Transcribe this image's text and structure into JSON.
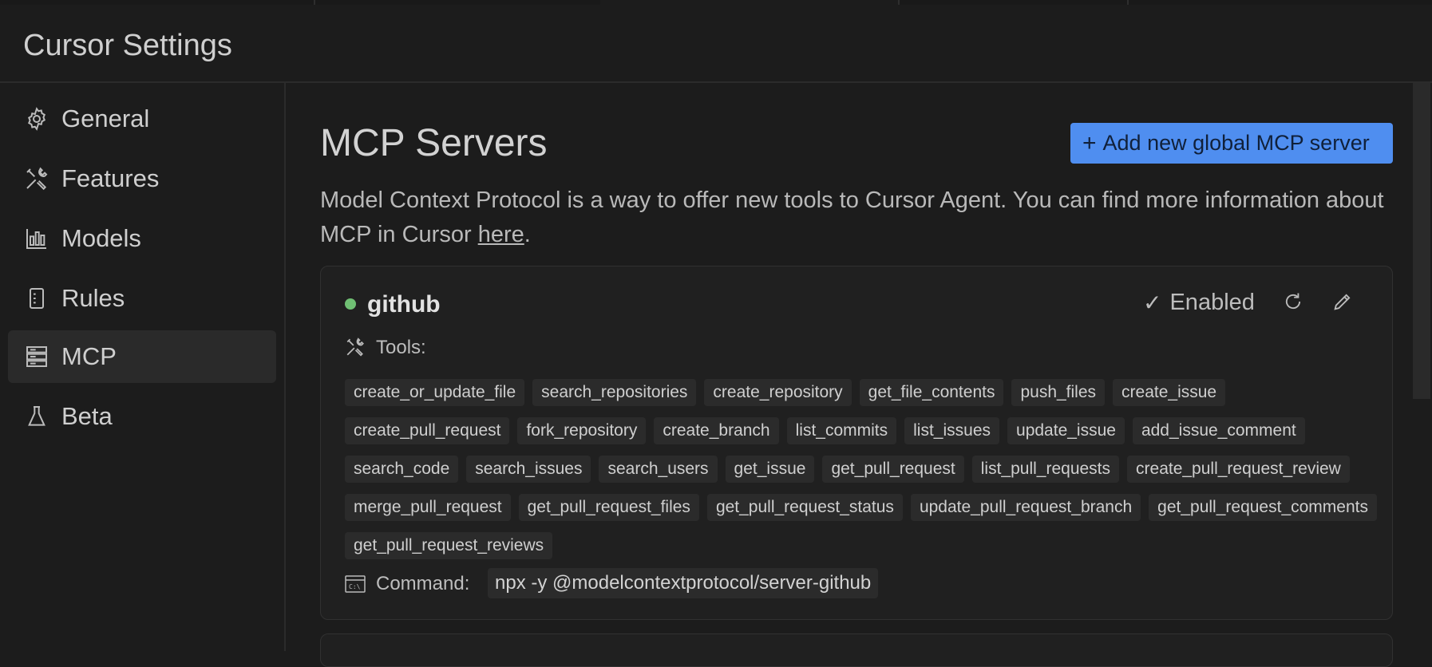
{
  "window": {
    "title": "Cursor Settings"
  },
  "sidebar": {
    "items": [
      {
        "label": "General",
        "icon": "gear-icon"
      },
      {
        "label": "Features",
        "icon": "tools-icon"
      },
      {
        "label": "Models",
        "icon": "bar-chart-icon"
      },
      {
        "label": "Rules",
        "icon": "rules-document-icon"
      },
      {
        "label": "MCP",
        "icon": "server-stack-icon",
        "active": true
      },
      {
        "label": "Beta",
        "icon": "flask-icon"
      }
    ]
  },
  "main": {
    "title": "MCP Servers",
    "add_button_label": "Add new global MCP server",
    "description_text": "Model Context Protocol is a way to offer new tools to Cursor Agent. You can find more information about MCP in Cursor ",
    "description_link": "here",
    "description_end": "."
  },
  "server": {
    "name": "github",
    "status": "enabled",
    "status_color": "#6fbf73",
    "enabled_label": "Enabled",
    "tools_label": "Tools:",
    "tools": [
      "create_or_update_file",
      "search_repositories",
      "create_repository",
      "get_file_contents",
      "push_files",
      "create_issue",
      "create_pull_request",
      "fork_repository",
      "create_branch",
      "list_commits",
      "list_issues",
      "update_issue",
      "add_issue_comment",
      "search_code",
      "search_issues",
      "search_users",
      "get_issue",
      "get_pull_request",
      "list_pull_requests",
      "create_pull_request_review",
      "merge_pull_request",
      "get_pull_request_files",
      "get_pull_request_status",
      "update_pull_request_branch",
      "get_pull_request_comments",
      "get_pull_request_reviews"
    ],
    "command_label": "Command:",
    "command": "npx -y @modelcontextprotocol/server-github"
  },
  "colors": {
    "accent": "#4f8ef0",
    "background": "#1c1c1c",
    "chip": "#2b2b2b"
  }
}
